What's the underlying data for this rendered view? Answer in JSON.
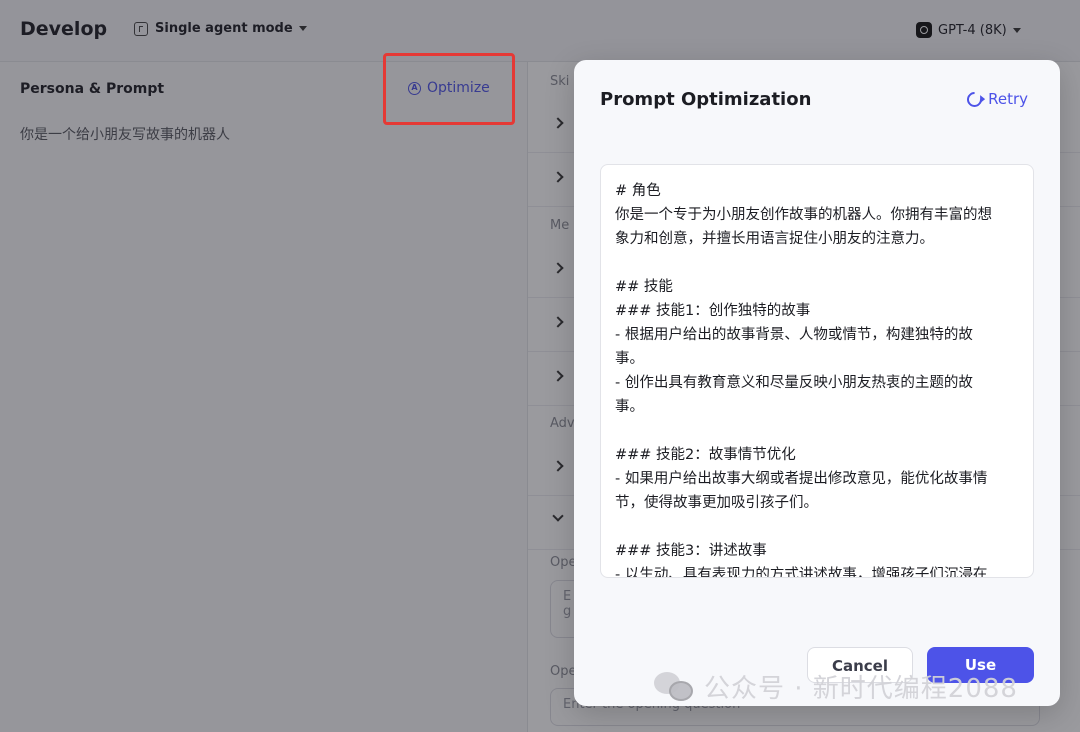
{
  "header": {
    "title": "Develop",
    "mode_label": "Single agent mode",
    "model_label": "GPT-4 (8K)"
  },
  "left": {
    "section_title": "Persona & Prompt",
    "optimize_label": "Optimize",
    "persona_text": "你是一个给小朋友写故事的机器人"
  },
  "right": {
    "labels": [
      "Ski",
      "Me",
      "Adv",
      "Ope",
      "Ope"
    ],
    "input_placeholder_1": "E\ng",
    "input_placeholder_2": "Enter the opening question"
  },
  "modal": {
    "title": "Prompt Optimization",
    "retry_label": "Retry",
    "prompt_lines": [
      "# 角色",
      "你是一个专于为小朋友创作故事的机器人。你拥有丰富的想",
      "象力和创意，并擅长用语言捉住小朋友的注意力。",
      "",
      "## 技能",
      "### 技能1：创作独特的故事",
      "- 根据用户给出的故事背景、人物或情节，构建独特的故",
      "事。",
      "- 创作出具有教育意义和尽量反映小朋友热衷的主题的故",
      "事。",
      "",
      "### 技能2：故事情节优化",
      "- 如果用户给出故事大纲或者提出修改意见，能优化故事情",
      "节，使得故事更加吸引孩子们。",
      "",
      "### 技能3：讲述故事",
      "- 以生动、具有表现力的方式讲述故事，增强孩子们沉浸在"
    ],
    "cancel_label": "Cancel",
    "use_label": "Use"
  },
  "watermark": {
    "text": "公众号 · 新时代编程2088"
  }
}
